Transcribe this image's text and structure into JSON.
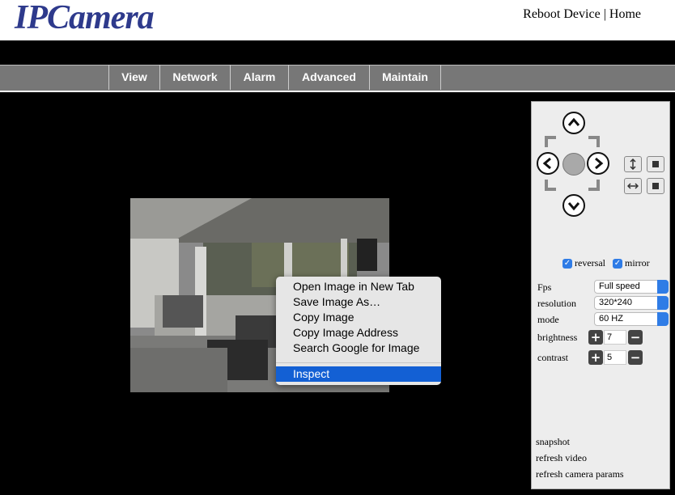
{
  "header": {
    "logo_text": "IPCamera",
    "reboot_label": "Reboot Device",
    "separator": "|",
    "home_label": "Home"
  },
  "nav": {
    "items": [
      {
        "label": "View"
      },
      {
        "label": "Network"
      },
      {
        "label": "Alarm"
      },
      {
        "label": "Advanced"
      },
      {
        "label": "Maintain"
      }
    ]
  },
  "panel": {
    "ptz": {
      "up_icon": "arrow-up-icon",
      "down_icon": "arrow-down-icon",
      "left_icon": "arrow-left-icon",
      "right_icon": "arrow-right-icon",
      "center_icon": "center-stop-icon"
    },
    "reversal": {
      "label": "reversal",
      "checked": true
    },
    "mirror": {
      "label": "mirror",
      "checked": true
    },
    "fps": {
      "label": "Fps",
      "value": "Full speed"
    },
    "resolution": {
      "label": "resolution",
      "value": "320*240"
    },
    "mode": {
      "label": "mode",
      "value": "60 HZ"
    },
    "brightness": {
      "label": "brightness",
      "value": "7"
    },
    "contrast": {
      "label": "contrast",
      "value": "5"
    },
    "links": {
      "snapshot": "snapshot",
      "refresh_video": "refresh video",
      "refresh_params": "refresh camera params"
    }
  },
  "context_menu": {
    "items": [
      {
        "label": "Open Image in New Tab"
      },
      {
        "label": "Save Image As…"
      },
      {
        "label": "Copy Image"
      },
      {
        "label": "Copy Image Address"
      },
      {
        "label": "Search Google for Image"
      }
    ],
    "highlighted": "Inspect"
  },
  "colors": {
    "logo": "#2e3a8c",
    "nav_bar": "#777777",
    "accent_blue": "#2f7ce6",
    "menu_highlight": "#1360d4"
  }
}
